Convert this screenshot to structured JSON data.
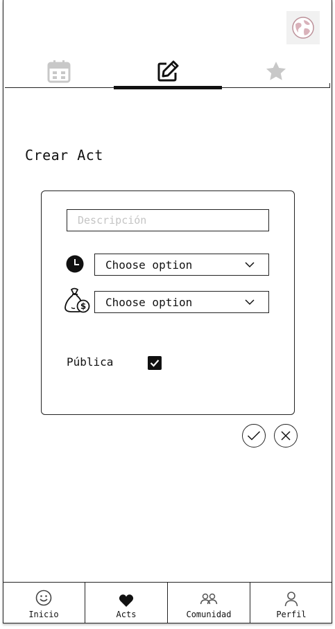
{
  "header": {
    "avatar_icon": "globe-avatar-icon"
  },
  "tabs": [
    {
      "icon": "calendar-icon",
      "active": false
    },
    {
      "icon": "edit-icon",
      "active": true
    },
    {
      "icon": "star-icon",
      "active": false
    }
  ],
  "page": {
    "title": "Crear Act"
  },
  "form": {
    "description_placeholder": "Descripción",
    "time_select": {
      "icon": "clock-icon",
      "value": "Choose option"
    },
    "cost_select": {
      "icon": "money-bag-icon",
      "value": "Choose option"
    },
    "public_label": "Pública",
    "public_checked": true
  },
  "actions": {
    "confirm_icon": "check-icon",
    "cancel_icon": "close-icon"
  },
  "bottom_nav": [
    {
      "label": "Inicio",
      "icon": "smiley-icon"
    },
    {
      "label": "Acts",
      "icon": "heart-icon"
    },
    {
      "label": "Comunidad",
      "icon": "people-icon"
    },
    {
      "label": "Perfil",
      "icon": "person-icon"
    }
  ],
  "colors": {
    "ink": "#111111",
    "muted_icon": "#c8c8c8",
    "placeholder": "#c4c4c4",
    "background": "#ffffff"
  }
}
